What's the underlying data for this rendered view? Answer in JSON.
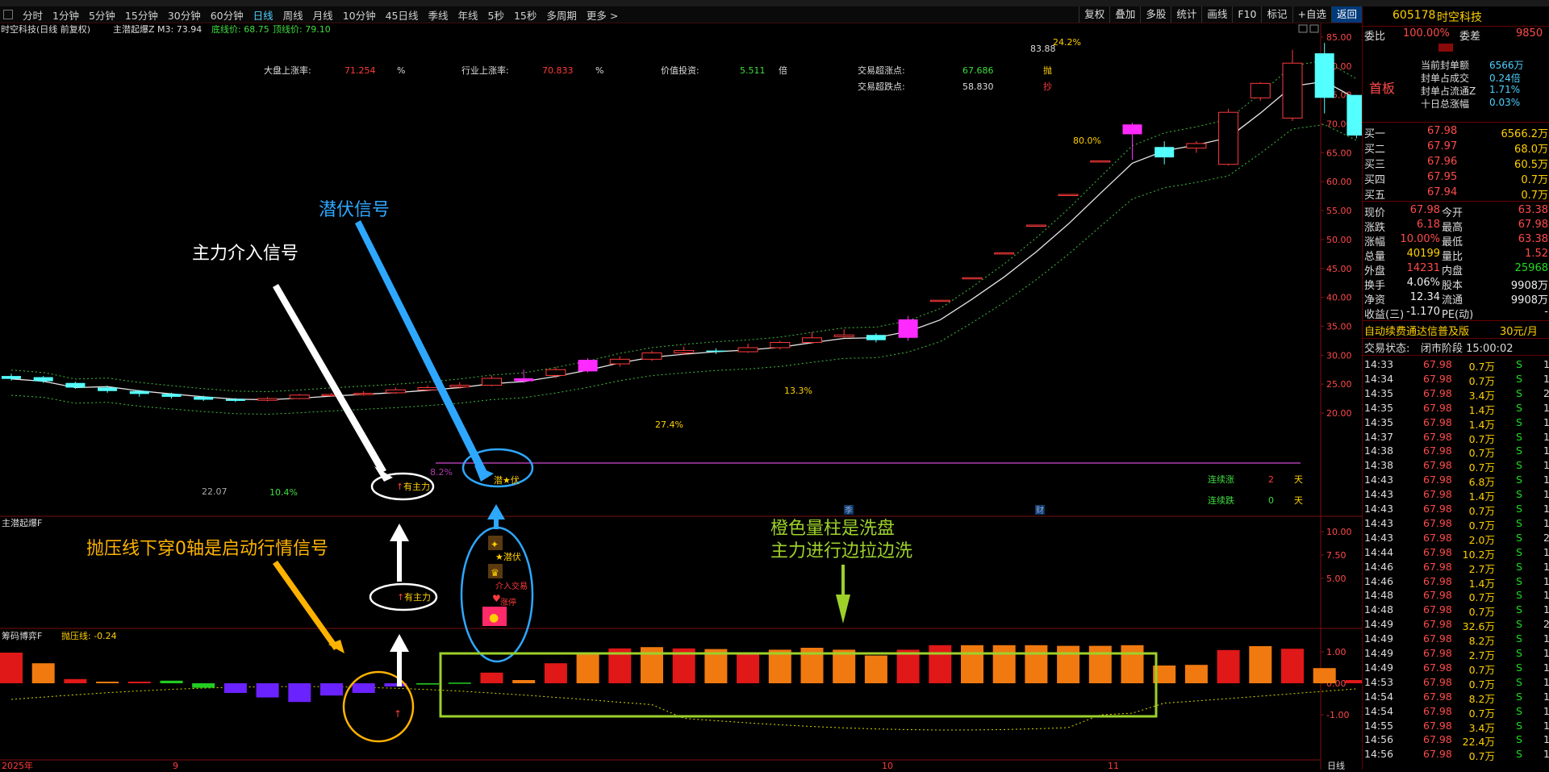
{
  "toolbar": {
    "periods": [
      "分时",
      "1分钟",
      "5分钟",
      "15分钟",
      "30分钟",
      "60分钟",
      "日线",
      "周线",
      "月线",
      "10分钟",
      "45日线",
      "季线",
      "年线",
      "5秒",
      "15秒",
      "多周期",
      "更多 >"
    ],
    "active_period": "日线",
    "right_buttons": [
      "复权",
      "叠加",
      "多股",
      "统计",
      "画线",
      "F10",
      "标记",
      "+自选",
      "返回"
    ]
  },
  "main_chart": {
    "header_title": "时空科技(日线 前复权)",
    "indicator_line": "主潜起爆Z M3: 73.94",
    "bottom_price": "底线价: 68.75",
    "top_price": "顶线价: 79.10",
    "stats": [
      {
        "label": "大盘上涨率:",
        "value": "71.254",
        "unit": "%"
      },
      {
        "label": "行业上涨率:",
        "value": "70.833",
        "unit": "%"
      },
      {
        "label": "价值投资:",
        "value": "5.511",
        "unit": "倍"
      },
      {
        "label": "交易超涨点:",
        "value": "67.686",
        "unit": "抛"
      },
      {
        "label": "交易超跌点:",
        "value": "58.830",
        "unit": "抄"
      }
    ],
    "y_axis": [
      "85.00",
      "80.00",
      "75.00",
      "70.00",
      "65.00",
      "60.00",
      "55.00",
      "50.00",
      "45.00",
      "40.00",
      "35.00",
      "30.00",
      "25.00",
      "20.00"
    ],
    "annotations": {
      "pct_83": "83.88",
      "pct_24": "24.2%",
      "pct_80": "80.0%",
      "pct_13": "13.3%",
      "pct_27": "27.4%",
      "pct_8": "8.2%",
      "pct_22": "22.07",
      "pct_10": "10.4%",
      "main_force": "有主力",
      "ambush": "潜★伏",
      "consec_up_label": "连续涨",
      "consec_up_value": "2",
      "consec_up_unit": "天",
      "consec_down_label": "连续跌",
      "consec_down_value": "0",
      "consec_down_unit": "天",
      "marker_a": "季",
      "marker_b": "财"
    }
  },
  "panel2": {
    "title": "主潜起爆F",
    "y_axis": [
      "10.00",
      "7.50",
      "5.00"
    ],
    "ambush_text": "★潜伏",
    "trade_text": "介入交易",
    "limit_text": "涨停",
    "main_force": "有主力"
  },
  "panel3": {
    "title": "筹码博弈F",
    "resist_line": "抛压线: -0.24",
    "y_axis": [
      "1.00",
      "0.00",
      "-1.00"
    ]
  },
  "x_axis": {
    "labels": [
      "2025年",
      "9",
      "10",
      "11"
    ],
    "right_label": "日线"
  },
  "callouts": {
    "ambush_signal": "潜伏信号",
    "main_force_signal": "主力介入信号",
    "resist_cross": "抛压线下穿0轴是启动行情信号",
    "orange_bar_line1": "橙色量柱是洗盘",
    "orange_bar_line2": "主力进行边拉边洗"
  },
  "side": {
    "code": "605178",
    "name": "时空科技",
    "weibi_label": "委比",
    "weibi": "100.00%",
    "weicha_label": "委差",
    "weicha": "9850",
    "board": "首板",
    "seal_info": [
      {
        "label": "当前封单额",
        "value": "6566万"
      },
      {
        "label": "封单占成交",
        "value": "0.24倍"
      },
      {
        "label": "封单占流通Z",
        "value": "1.71%"
      },
      {
        "label": "十日总涨幅",
        "value": "0.03%"
      }
    ],
    "bids": [
      {
        "label": "买一",
        "price": "67.98",
        "vol": "6566.2万"
      },
      {
        "label": "买二",
        "price": "67.97",
        "vol": "68.0万"
      },
      {
        "label": "买三",
        "price": "67.96",
        "vol": "60.5万"
      },
      {
        "label": "买四",
        "price": "67.95",
        "vol": "0.7万"
      },
      {
        "label": "买五",
        "price": "67.94",
        "vol": "0.7万"
      }
    ],
    "quote": [
      {
        "l1": "现价",
        "v1": "67.98",
        "l2": "今开",
        "v2": "63.38"
      },
      {
        "l1": "涨跌",
        "v1": "6.18",
        "l2": "最高",
        "v2": "67.98"
      },
      {
        "l1": "涨幅",
        "v1": "10.00%",
        "l2": "最低",
        "v2": "63.38"
      },
      {
        "l1": "总量",
        "v1": "40199",
        "l2": "量比",
        "v2": "1.52"
      },
      {
        "l1": "外盘",
        "v1": "14231",
        "l2": "内盘",
        "v2": "25968"
      },
      {
        "l1": "换手",
        "v1": "4.06%",
        "l2": "股本",
        "v2": "9908万"
      },
      {
        "l1": "净资",
        "v1": "12.34",
        "l2": "流通",
        "v2": "9908万"
      },
      {
        "l1": "收益(三)",
        "v1": "-1.170",
        "l2": "PE(动)",
        "v2": "-"
      }
    ],
    "promo": "自动续费通达信普及版",
    "promo_price": "30元/月",
    "status_label": "交易状态:",
    "status": "闭市阶段 15:00:02",
    "trades": [
      {
        "t": "14:33",
        "p": "67.98",
        "v": "0.7万",
        "s": "S",
        "n": "1"
      },
      {
        "t": "14:34",
        "p": "67.98",
        "v": "0.7万",
        "s": "S",
        "n": "1"
      },
      {
        "t": "14:35",
        "p": "67.98",
        "v": "3.4万",
        "s": "S",
        "n": "2"
      },
      {
        "t": "14:35",
        "p": "67.98",
        "v": "1.4万",
        "s": "S",
        "n": "1"
      },
      {
        "t": "14:35",
        "p": "67.98",
        "v": "1.4万",
        "s": "S",
        "n": "1"
      },
      {
        "t": "14:37",
        "p": "67.98",
        "v": "0.7万",
        "s": "S",
        "n": "1"
      },
      {
        "t": "14:38",
        "p": "67.98",
        "v": "0.7万",
        "s": "S",
        "n": "1"
      },
      {
        "t": "14:38",
        "p": "67.98",
        "v": "0.7万",
        "s": "S",
        "n": "1"
      },
      {
        "t": "14:43",
        "p": "67.98",
        "v": "6.8万",
        "s": "S",
        "n": "1"
      },
      {
        "t": "14:43",
        "p": "67.98",
        "v": "1.4万",
        "s": "S",
        "n": "1"
      },
      {
        "t": "14:43",
        "p": "67.98",
        "v": "0.7万",
        "s": "S",
        "n": "1"
      },
      {
        "t": "14:43",
        "p": "67.98",
        "v": "0.7万",
        "s": "S",
        "n": "1"
      },
      {
        "t": "14:43",
        "p": "67.98",
        "v": "2.0万",
        "s": "S",
        "n": "2"
      },
      {
        "t": "14:44",
        "p": "67.98",
        "v": "10.2万",
        "s": "S",
        "n": "1"
      },
      {
        "t": "14:46",
        "p": "67.98",
        "v": "2.7万",
        "s": "S",
        "n": "1"
      },
      {
        "t": "14:46",
        "p": "67.98",
        "v": "1.4万",
        "s": "S",
        "n": "1"
      },
      {
        "t": "14:48",
        "p": "67.98",
        "v": "0.7万",
        "s": "S",
        "n": "1"
      },
      {
        "t": "14:48",
        "p": "67.98",
        "v": "0.7万",
        "s": "S",
        "n": "1"
      },
      {
        "t": "14:49",
        "p": "67.98",
        "v": "32.6万",
        "s": "S",
        "n": "2"
      },
      {
        "t": "14:49",
        "p": "67.98",
        "v": "8.2万",
        "s": "S",
        "n": "1"
      },
      {
        "t": "14:49",
        "p": "67.98",
        "v": "2.7万",
        "s": "S",
        "n": "1"
      },
      {
        "t": "14:49",
        "p": "67.98",
        "v": "0.7万",
        "s": "S",
        "n": "1"
      },
      {
        "t": "14:53",
        "p": "67.98",
        "v": "0.7万",
        "s": "S",
        "n": "1"
      },
      {
        "t": "14:54",
        "p": "67.98",
        "v": "8.2万",
        "s": "S",
        "n": "1"
      },
      {
        "t": "14:54",
        "p": "67.98",
        "v": "0.7万",
        "s": "S",
        "n": "1"
      },
      {
        "t": "14:55",
        "p": "67.98",
        "v": "3.4万",
        "s": "S",
        "n": "1"
      },
      {
        "t": "14:56",
        "p": "67.98",
        "v": "22.4万",
        "s": "S",
        "n": "1"
      },
      {
        "t": "14:56",
        "p": "67.98",
        "v": "0.7万",
        "s": "S",
        "n": "1"
      }
    ]
  },
  "chart_data": {
    "type": "candlestick",
    "y_range": [
      18.5,
      86
    ],
    "candles": [
      [
        26.4,
        25.9,
        26.8,
        25.6
      ],
      [
        26.2,
        25.5,
        26.4,
        25.2
      ],
      [
        25.2,
        24.4,
        25.4,
        24.2
      ],
      [
        24.4,
        23.8,
        24.7,
        23.5
      ],
      [
        23.8,
        23.3,
        24.0,
        22.8
      ],
      [
        23.3,
        22.8,
        23.5,
        22.5
      ],
      [
        22.8,
        22.3,
        23.0,
        22.1
      ],
      [
        22.4,
        22.1,
        22.6,
        21.9
      ],
      [
        22.2,
        22.5,
        22.8,
        22.0
      ],
      [
        22.5,
        23.1,
        23.3,
        22.4
      ],
      [
        23.0,
        23.2,
        23.5,
        22.8
      ],
      [
        23.2,
        23.4,
        23.8,
        23.0
      ],
      [
        23.5,
        24.0,
        24.4,
        23.3
      ],
      [
        24.0,
        24.4,
        24.8,
        23.8
      ],
      [
        24.5,
        24.8,
        25.3,
        24.2
      ],
      [
        24.8,
        26.0,
        26.5,
        24.6
      ],
      [
        26.0,
        25.5,
        27.5,
        25.2
      ],
      [
        26.5,
        27.5,
        28.0,
        26.0
      ],
      [
        27.2,
        29.2,
        29.5,
        27.0
      ],
      [
        28.5,
        29.3,
        29.8,
        28.0
      ],
      [
        29.3,
        30.4,
        30.8,
        29.0
      ],
      [
        30.4,
        30.8,
        31.5,
        30.0
      ],
      [
        30.8,
        30.6,
        31.2,
        30.2
      ],
      [
        30.6,
        31.3,
        32.0,
        30.4
      ],
      [
        31.3,
        32.2,
        32.5,
        31.0
      ],
      [
        32.2,
        33.0,
        34.0,
        32.0
      ],
      [
        33.2,
        33.5,
        34.5,
        33.0
      ],
      [
        33.5,
        32.6,
        33.8,
        32.2
      ],
      [
        33.0,
        36.2,
        36.8,
        32.5
      ],
      [
        39.5,
        39.5,
        39.5,
        39.5
      ],
      [
        43.4,
        43.4,
        43.4,
        43.4
      ],
      [
        47.7,
        47.7,
        47.7,
        47.7
      ],
      [
        52.5,
        52.5,
        52.5,
        52.5
      ],
      [
        57.8,
        57.8,
        57.8,
        57.8
      ],
      [
        63.6,
        63.6,
        63.6,
        63.6
      ],
      [
        69.9,
        68.2,
        70.2,
        63.8
      ],
      [
        66.0,
        64.2,
        67.0,
        63.0
      ],
      [
        65.8,
        66.6,
        67.0,
        65.0
      ],
      [
        63.0,
        72.0,
        72.6,
        62.8
      ],
      [
        74.5,
        77.0,
        77.2,
        74.0
      ],
      [
        71.0,
        80.5,
        82.8,
        70.5
      ],
      [
        82.2,
        74.5,
        84.0,
        71.8
      ],
      [
        75.0,
        67.98,
        75.0,
        67.5
      ]
    ],
    "pct_labels": [
      "83.88",
      "24.2%",
      "80.0%",
      "13.3%",
      "27.4%",
      "8.2%",
      "22.07",
      "10.4%"
    ],
    "volume_bars": [
      0.95,
      0.62,
      0.13,
      0.05,
      0.05,
      0.08,
      -0.14,
      -0.3,
      -0.44,
      -0.58,
      -0.38,
      -0.3,
      -0.1,
      -0.04,
      0.02,
      0.33,
      0.1,
      0.62,
      0.96,
      1.08,
      1.12,
      1.08,
      1.06,
      0.9,
      1.04,
      1.1,
      1.04,
      0.86,
      1.04,
      1.18,
      1.18,
      1.18,
      1.18,
      1.16,
      1.16,
      1.18,
      0.55,
      0.57,
      1.03,
      1.15,
      1.07,
      0.47,
      0.1
    ],
    "volume_orange": [
      1,
      3,
      13,
      16,
      18,
      20,
      22,
      24,
      25,
      26,
      27,
      30,
      31,
      32,
      33,
      34,
      35,
      36,
      37,
      39,
      41
    ],
    "volume_green": [
      5,
      6,
      13,
      14
    ],
    "volume_purple": [
      7,
      8,
      9,
      10,
      11,
      12
    ]
  }
}
